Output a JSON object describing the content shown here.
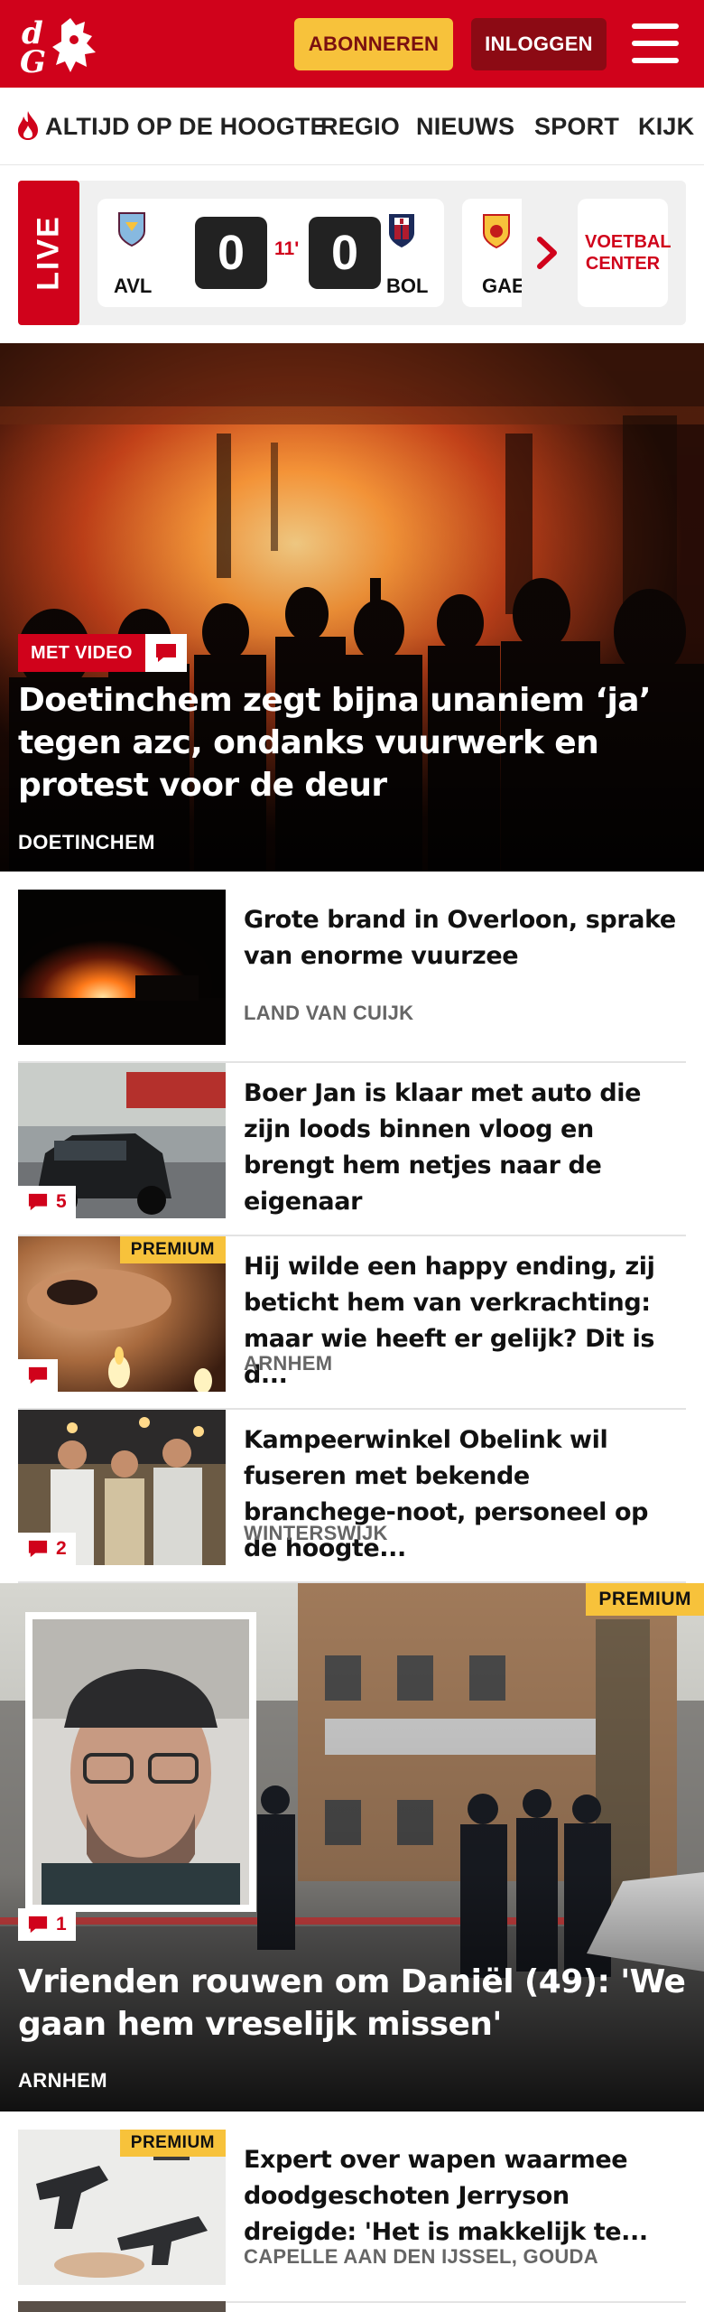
{
  "header": {
    "logo_text": "dG",
    "subscribe_label": "ABONNEREN",
    "login_label": "INLOGGEN",
    "brand_color": "#d0021b"
  },
  "nav": {
    "items": [
      "ALTIJD OP DE HOOGTE",
      "REGIO",
      "NIEUWS",
      "SPORT",
      "KIJK"
    ]
  },
  "live": {
    "label": "LIVE",
    "match": {
      "home": "AVL",
      "home_score": "0",
      "minute": "11'",
      "away_score": "0",
      "away": "BOL"
    },
    "next_team": "GAE",
    "voetbal_center": "VOETBAL CENTER"
  },
  "hero": {
    "badge": "MET VIDEO",
    "title": "Doetinchem zegt bijna unaniem ‘ja’ tegen azc, ondanks vuurwerk en protest voor de deur",
    "location": "DOETINCHEM"
  },
  "articles": [
    {
      "title": "Grote brand in Overloon, sprake van enorme vuurzee",
      "location": "LAND VAN CUIJK",
      "premium": false,
      "comments": ""
    },
    {
      "title": "Boer Jan is klaar met auto die zijn loods binnen vloog en brengt hem netjes naar de eigenaar",
      "location": "",
      "premium": false,
      "comments": "5"
    },
    {
      "title": "Hij wilde een happy ending, zij beticht hem van verkrachting: maar wie heeft er gelijk? Dit is d...",
      "location": "ARNHEM",
      "premium": true,
      "premium_label": "PREMIUM",
      "comments": ""
    },
    {
      "title": "Kampeerwinkel Obelink wil fuseren met bekende branchege-noot, personeel op de hoogte...",
      "location": "WINTERSWIJK",
      "premium": false,
      "comments": "2"
    }
  ],
  "feature": {
    "premium_label": "PREMIUM",
    "comments": "1",
    "title": "Vrienden rouwen om Daniël (49): 'We gaan hem vreselijk missen'",
    "location": "ARNHEM"
  },
  "article_bottom": {
    "premium_label": "PREMIUM",
    "title": "Expert over wapen waarmee doodgeschoten Jerryson dreigde: 'Het is makkelijk te...",
    "location": "CAPELLE AAN DEN IJSSEL, GOUDA"
  }
}
